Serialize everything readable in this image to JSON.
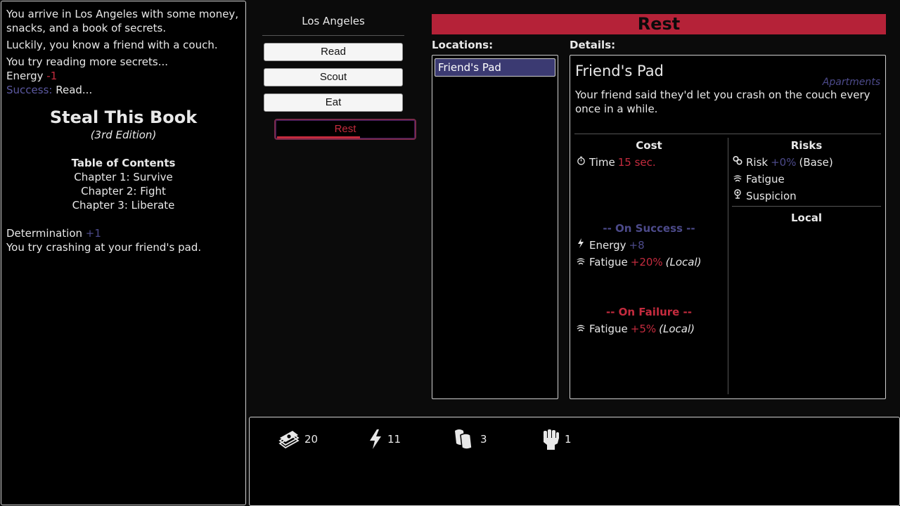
{
  "log": {
    "lines": [
      "You arrive in Los Angeles with some money, snacks, and a book of secrets.",
      "Luckily, you know a friend with a couch.",
      "You try reading more secrets..."
    ],
    "energy_label": "Energy",
    "energy_value": "-1",
    "success_label": "Success:",
    "success_text": "Read...",
    "book_title": "Steal This Book",
    "book_edition": "(3rd Edition)",
    "toc_heading": "Table of Contents",
    "toc": [
      "Chapter 1: Survive",
      "Chapter 2: Fight",
      "Chapter 3: Liberate"
    ],
    "determination_label": "Determination",
    "determination_value": "+1",
    "last_line": "You try crashing at your friend's pad."
  },
  "city": "Los Angeles",
  "actions": [
    "Read",
    "Scout",
    "Eat",
    "Rest"
  ],
  "selected_action": "Rest",
  "panel_title": "Rest",
  "locations_label": "Locations:",
  "details_label": "Details:",
  "locations": [
    "Friend's Pad"
  ],
  "details": {
    "name": "Friend's Pad",
    "category": "Apartments",
    "description": "Your friend said they'd let you crash on the couch every once in a while.",
    "cost_heading": "Cost",
    "time_label": "Time",
    "time_value": "15 sec.",
    "on_success": "-- On Success --",
    "succ_energy_label": "Energy",
    "succ_energy_value": "+8",
    "succ_fatigue_label": "Fatigue",
    "succ_fatigue_value": "+20%",
    "succ_fatigue_scope": "(Local)",
    "on_failure": "-- On Failure --",
    "fail_fatigue_label": "Fatigue",
    "fail_fatigue_value": "+5%",
    "fail_fatigue_scope": "(Local)",
    "risks_heading": "Risks",
    "risk_label": "Risk",
    "risk_value": "+0%",
    "risk_base": "(Base)",
    "risk_fatigue": "Fatigue",
    "risk_suspicion": "Suspicion",
    "local_heading": "Local"
  },
  "status": {
    "money": "20",
    "energy": "11",
    "snacks": "3",
    "determination": "1"
  },
  "colors": {
    "accent_red": "#b52238",
    "accent_purple": "#3b3a72",
    "negative": "#c42b3e",
    "positive": "#4c4a8a"
  }
}
